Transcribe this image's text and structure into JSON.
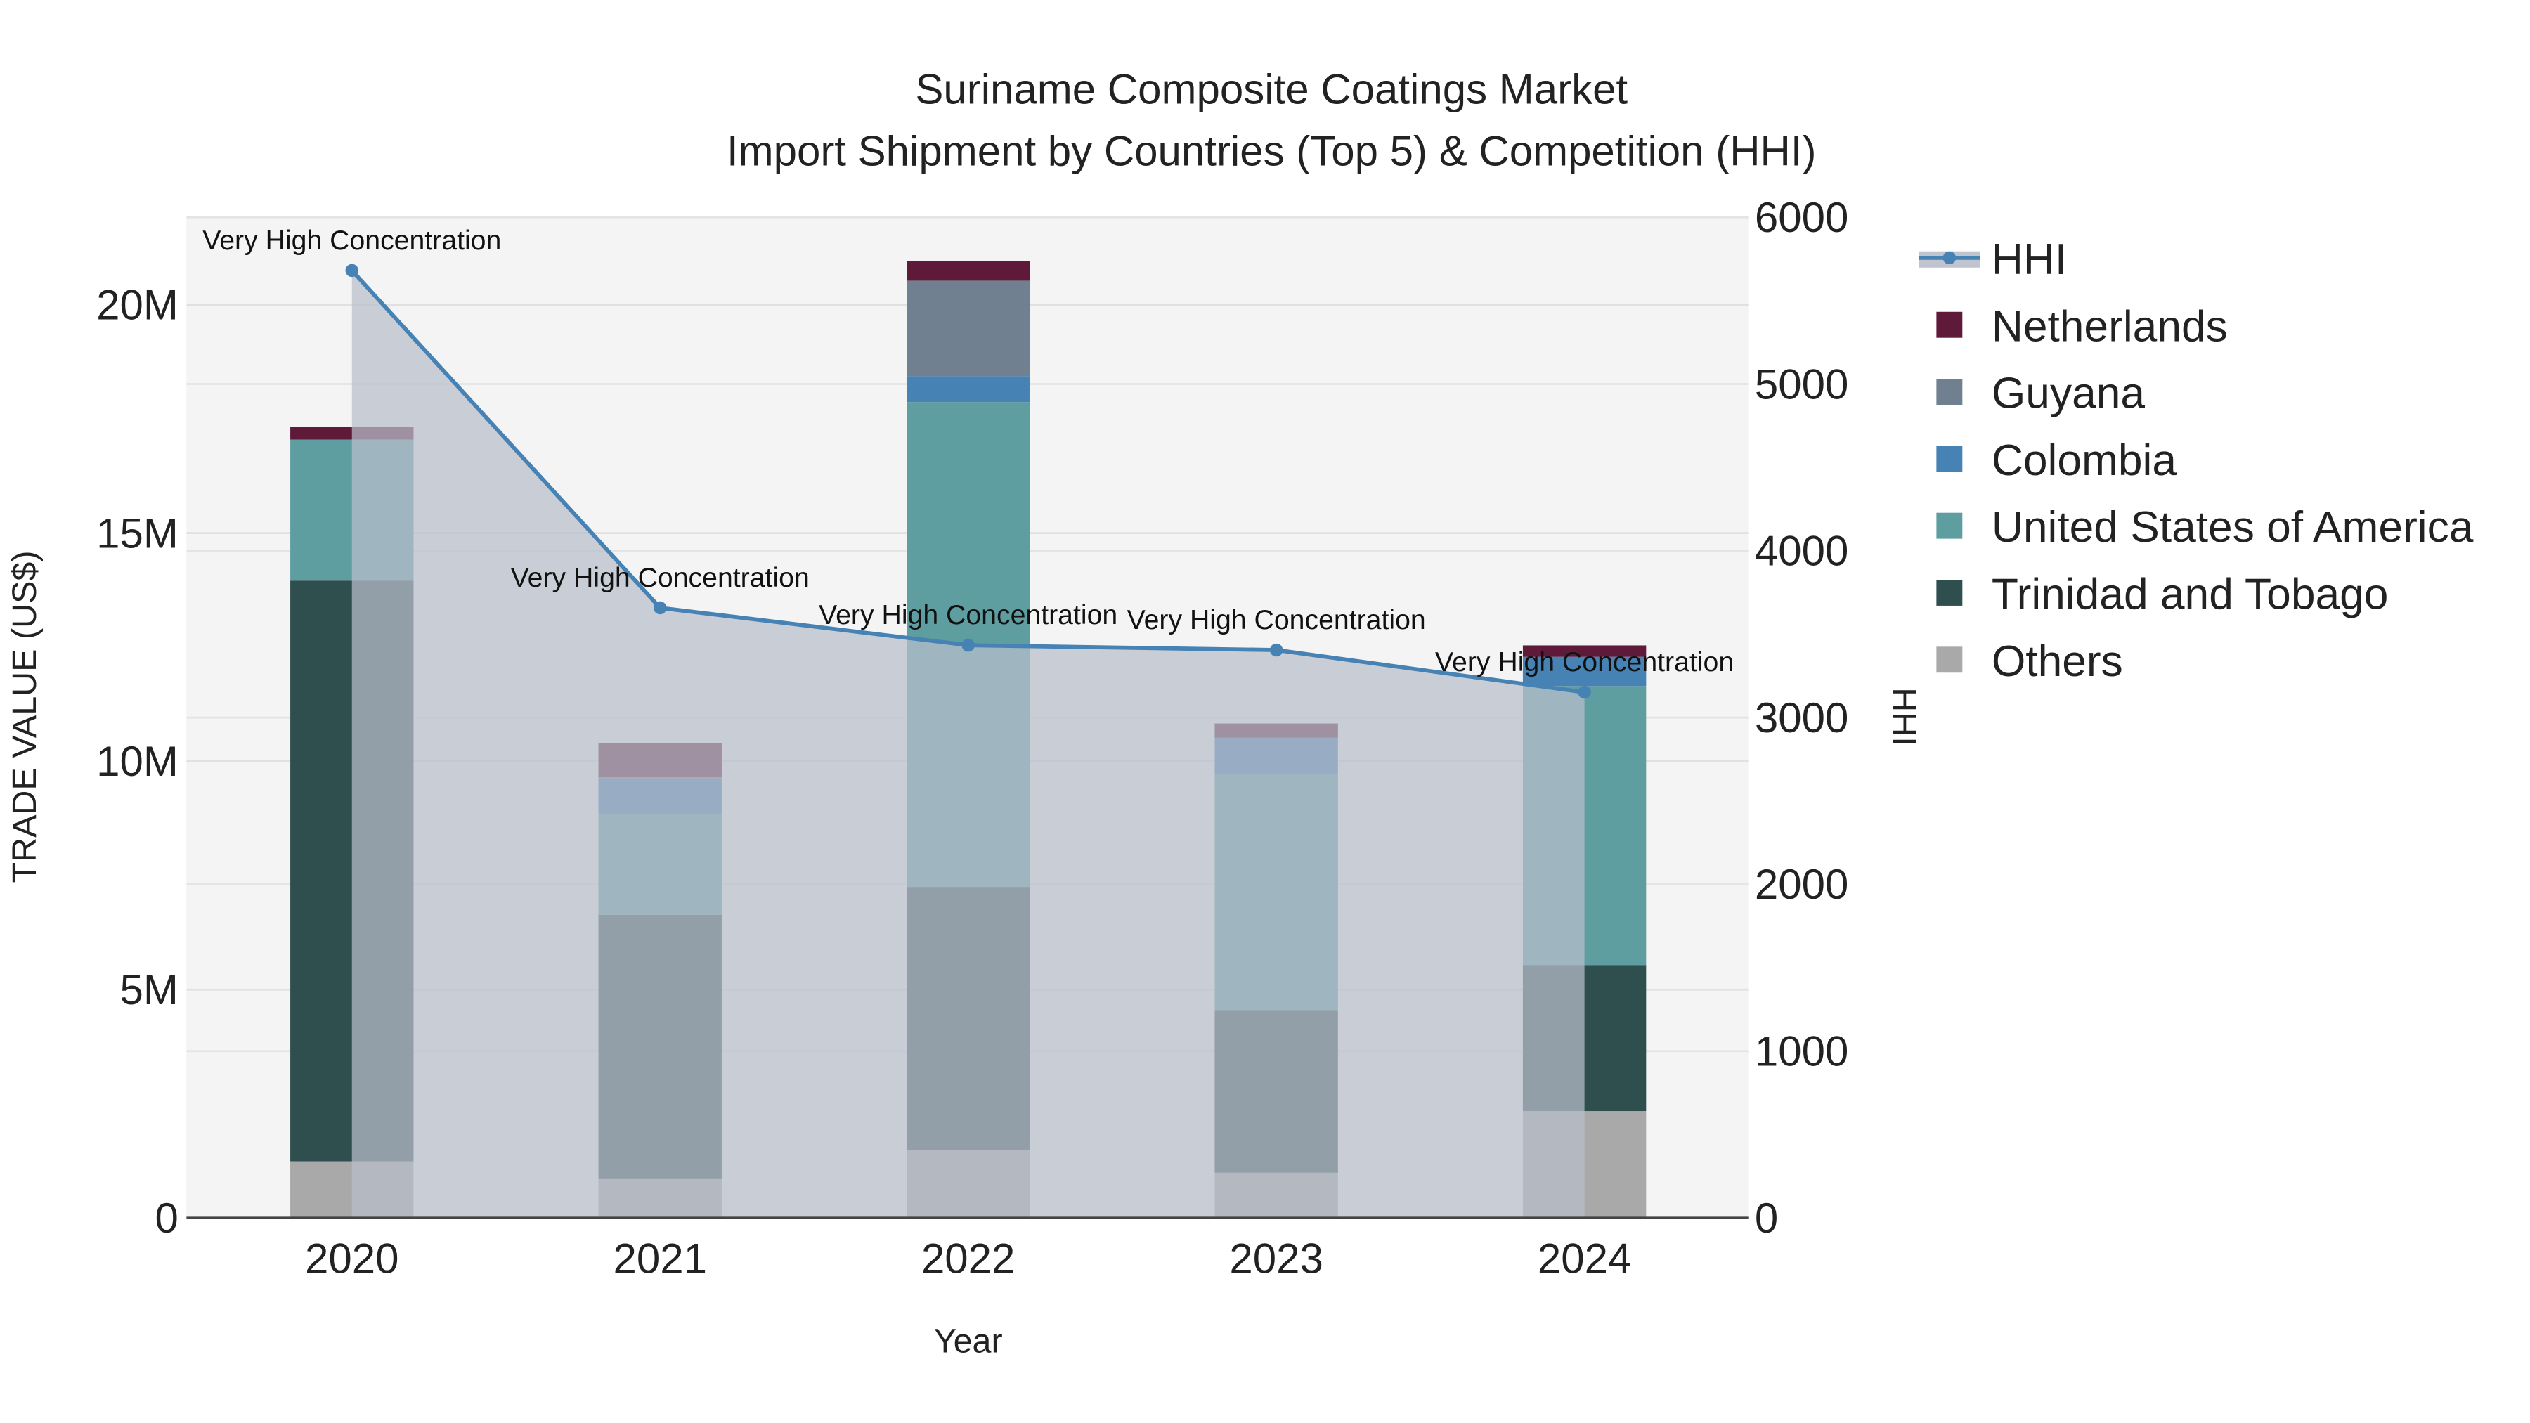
{
  "chart_data": {
    "type": "bar",
    "title": "Suriname Composite Coatings Market",
    "subtitle": "Import Shipment by Countries (Top 5) & Competition (HHI)",
    "xlabel": "Year",
    "ylabel": "TRADE VALUE (US$)",
    "y2label": "HHI",
    "categories": [
      "2020",
      "2021",
      "2022",
      "2023",
      "2024"
    ],
    "ylim": [
      0,
      22000000
    ],
    "y2lim": [
      0,
      6000
    ],
    "yticks": [
      {
        "v": 0,
        "label": "0"
      },
      {
        "v": 5000000,
        "label": "5M"
      },
      {
        "v": 10000000,
        "label": "10M"
      },
      {
        "v": 15000000,
        "label": "15M"
      },
      {
        "v": 20000000,
        "label": "20M"
      }
    ],
    "y2ticks": [
      {
        "v": 0,
        "label": "0"
      },
      {
        "v": 1000,
        "label": "1000"
      },
      {
        "v": 2000,
        "label": "2000"
      },
      {
        "v": 3000,
        "label": "3000"
      },
      {
        "v": 4000,
        "label": "4000"
      },
      {
        "v": 5000,
        "label": "5000"
      },
      {
        "v": 6000,
        "label": "6000"
      }
    ],
    "series": [
      {
        "name": "Others",
        "color": "#a9a9a9",
        "values": [
          1240000,
          850000,
          1490000,
          990000,
          2340000
        ]
      },
      {
        "name": "Trinidad and Tobago",
        "color": "#2f4f4f",
        "values": [
          12720000,
          5790000,
          5760000,
          3560000,
          3200000
        ]
      },
      {
        "name": "United States of America",
        "color": "#5f9ea0",
        "values": [
          3090000,
          2200000,
          10620000,
          5180000,
          6110000
        ]
      },
      {
        "name": "Colombia",
        "color": "#4682b4",
        "values": [
          0,
          780000,
          570000,
          790000,
          640000
        ]
      },
      {
        "name": "Guyana",
        "color": "#708090",
        "values": [
          0,
          30000,
          2090000,
          0,
          0
        ]
      },
      {
        "name": "Netherlands",
        "color": "#5f1a3a",
        "values": [
          280000,
          750000,
          430000,
          310000,
          250000
        ]
      }
    ],
    "hhi": {
      "name": "HHI",
      "color": "#4682b4",
      "values": [
        5681,
        3658,
        3434,
        3405,
        3152
      ],
      "annotations": [
        "Very High Concentration",
        "Very High Concentration",
        "Very High Concentration",
        "Very High Concentration",
        "Very High Concentration"
      ]
    },
    "legend": [
      "HHI",
      "Netherlands",
      "Guyana",
      "Colombia",
      "United States of America",
      "Trinidad and Tobago",
      "Others"
    ],
    "legend_position": "right",
    "grid": true
  }
}
